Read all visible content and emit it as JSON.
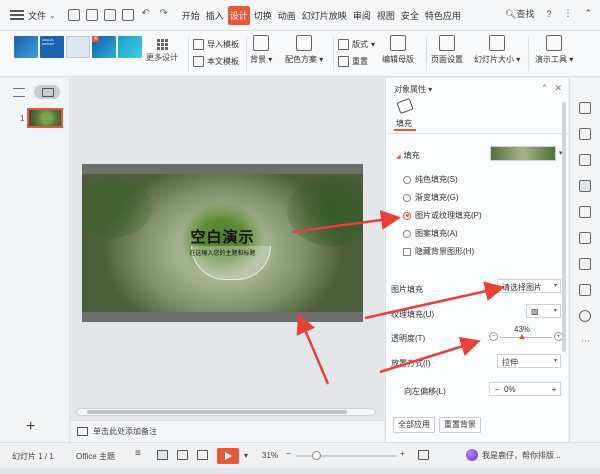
{
  "menubar": {
    "file": "文件",
    "tabs": [
      "开始",
      "插入",
      "设计",
      "切换",
      "动画",
      "幻灯片放映",
      "审阅",
      "视图",
      "安全",
      "特色应用"
    ],
    "active_tab": "设计",
    "search": "查找",
    "help": "?"
  },
  "ribbon": {
    "theme_thumb_texts": [
      "",
      "ANNUAL REPORT",
      "",
      "",
      ""
    ],
    "theme_badge": "4",
    "more_design": "更多设计",
    "import_template": "导入模板",
    "text_template": "本文模板",
    "background": "背景",
    "color_scheme": "配色方案",
    "layout": "版式",
    "reset": "重置",
    "edit_master": "编辑母版",
    "page_setup": "页面设置",
    "slide_size": "幻灯片大小",
    "presentation_tools": "演示工具"
  },
  "slidepanel": {
    "slide_number": "1",
    "add_label": "+"
  },
  "slide": {
    "title": "空白演示",
    "subtitle": "在这输入您的主题和标题"
  },
  "notes": {
    "placeholder": "单击此处添加备注"
  },
  "props": {
    "header": "对象属性",
    "tab_fill": "填充",
    "section_fill": "填充",
    "options": [
      {
        "label": "纯色填充(S)",
        "selected": false
      },
      {
        "label": "渐变填充(G)",
        "selected": false
      },
      {
        "label": "图片或纹理填充(P)",
        "selected": true
      },
      {
        "label": "图案填充(A)",
        "selected": false
      }
    ],
    "hide_bg_label": "隐藏背景图形(H)",
    "picture_fill_label": "图片填充",
    "picture_fill_value": "请选择图片",
    "texture_fill_label": "纹理填充(U)",
    "transparency_label": "透明度(T)",
    "transparency_value": "43%",
    "transparency_level": 0.43,
    "placement_label": "放置方式(I)",
    "placement_value": "拉伸",
    "offset_left_label": "向左偏移(L)",
    "offset_left_value": "0%",
    "apply_all": "全部应用",
    "reset_bg": "重置背景"
  },
  "status": {
    "slide_info": "幻灯片 1 / 1",
    "theme": "Office 主题",
    "zoom": "31%",
    "zoom_level": 0.31,
    "assistant": "我是鹿仔，帮你排版..."
  },
  "colors": {
    "accent": "#e8593a"
  }
}
